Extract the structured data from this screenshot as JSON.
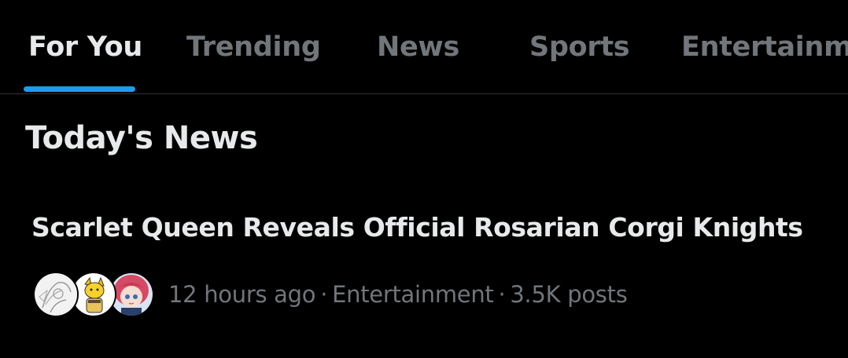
{
  "tabs": [
    {
      "label": "For You",
      "active": true
    },
    {
      "label": "Trending",
      "active": false
    },
    {
      "label": "News",
      "active": false
    },
    {
      "label": "Sports",
      "active": false
    },
    {
      "label": "Entertainment",
      "active": false
    }
  ],
  "section": {
    "title": "Today's News"
  },
  "news_item": {
    "headline": "Scarlet Queen Reveals Official Rosarian Corgi Knights",
    "time": "12 hours ago",
    "category": "Entertainment",
    "post_count": "3.5K posts",
    "separator": "·",
    "avatars": [
      "sketch-avatar",
      "yellow-character-avatar",
      "red-haired-character-avatar"
    ]
  },
  "colors": {
    "background": "#000000",
    "text_primary": "#e7e9ea",
    "text_secondary": "#71767b",
    "accent": "#1d9bf0",
    "divider": "#2f3336"
  }
}
